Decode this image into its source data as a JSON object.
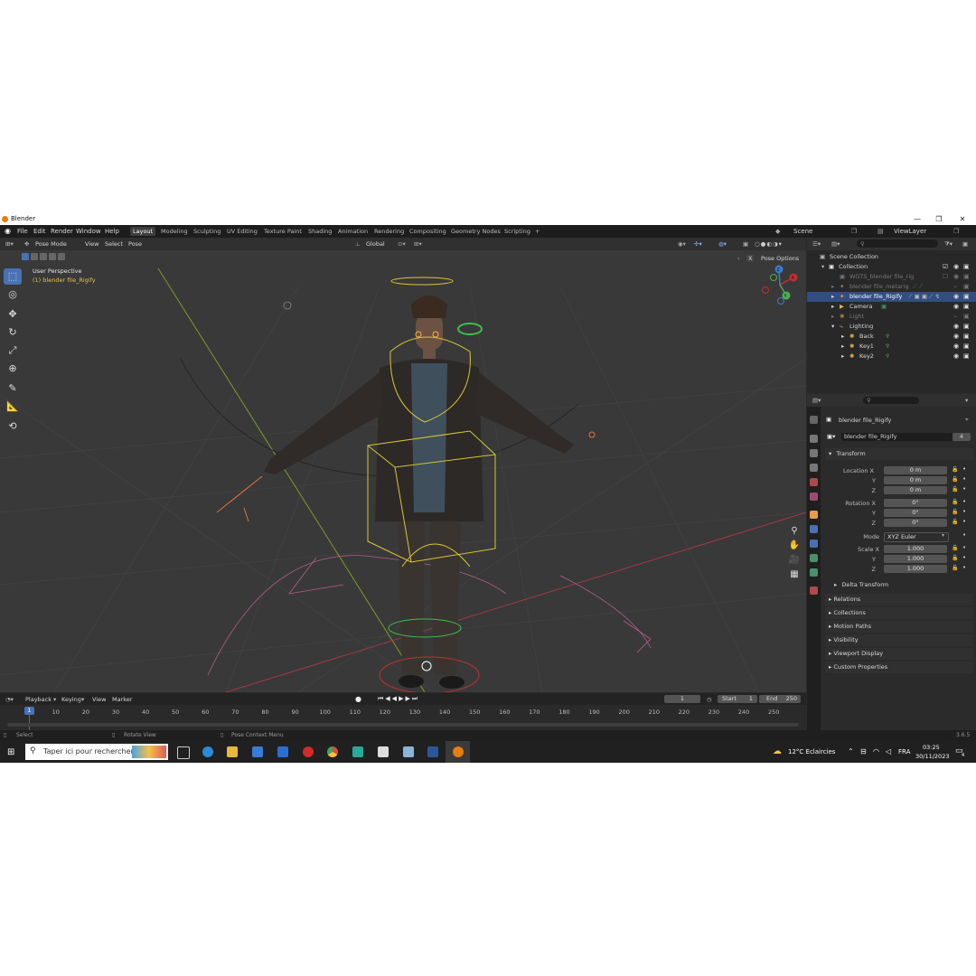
{
  "window": {
    "title": "Blender",
    "minimize": "—",
    "maximize": "❐",
    "close": "✕"
  },
  "menu": [
    "File",
    "Edit",
    "Render",
    "Window",
    "Help"
  ],
  "workspaces": [
    "Layout",
    "Modeling",
    "Sculpting",
    "UV Editing",
    "Texture Paint",
    "Shading",
    "Animation",
    "Rendering",
    "Compositing",
    "Geometry Nodes",
    "Scripting",
    "+"
  ],
  "scene": {
    "name": "Scene",
    "view_layer": "ViewLayer"
  },
  "viewport": {
    "mode": "Pose Mode",
    "header_menus": [
      "View",
      "Select",
      "Pose"
    ],
    "orientation": "Global",
    "pose_options": "Pose Options",
    "title": "User Perspective",
    "subtitle": "(1) blender file_Rigify",
    "x_button": "X",
    "gizmo": {
      "x": "X",
      "y": "Y",
      "z": "Z"
    }
  },
  "outliner": {
    "rows": [
      {
        "label": "Scene Collection"
      },
      {
        "label": "Collection"
      },
      {
        "label": "WGTS_blender file_rig"
      },
      {
        "label": "blender file_metarig"
      },
      {
        "label": "blender file_Rigify"
      },
      {
        "label": "Camera"
      },
      {
        "label": "Light"
      },
      {
        "label": "Lighting"
      },
      {
        "label": "Back"
      },
      {
        "label": "Key1"
      },
      {
        "label": "Key2"
      }
    ]
  },
  "properties": {
    "object_name": "blender file_Rigify",
    "data_name": "blender file_Rigify",
    "users": "4",
    "transform": {
      "header": "Transform",
      "location_label": "Location X",
      "location": [
        "0 m",
        "0 m",
        "0 m"
      ],
      "rotation_label": "Rotation X",
      "rotation": [
        "0°",
        "0°",
        "0°"
      ],
      "mode_label": "Mode",
      "mode": "XYZ Euler",
      "scale_label": "Scale X",
      "scale": [
        "1.000",
        "1.000",
        "1.000"
      ],
      "y": "Y",
      "z": "Z"
    },
    "delta": "Delta Transform",
    "panels": [
      "Relations",
      "Collections",
      "Motion Paths",
      "Visibility",
      "Viewport Display",
      "Custom Properties"
    ]
  },
  "timeline": {
    "menus": [
      "Playback",
      "Keying",
      "View",
      "Marker"
    ],
    "current_frame": "1",
    "start_label": "Start",
    "start": "1",
    "end_label": "End",
    "end": "250",
    "ruler": [
      "1",
      "10",
      "20",
      "30",
      "40",
      "50",
      "60",
      "70",
      "80",
      "90",
      "100",
      "110",
      "120",
      "130",
      "140",
      "150",
      "160",
      "170",
      "180",
      "190",
      "200",
      "210",
      "220",
      "230",
      "240",
      "250"
    ]
  },
  "statusbar": {
    "select": "Select",
    "rotate": "Rotate View",
    "context": "Pose Context Menu",
    "version": "3.6.5"
  },
  "taskbar": {
    "search_placeholder": "Taper ici pour rechercher",
    "weather": "12°C  Eclaircies",
    "language": "FRA",
    "time": "03:25",
    "date": "30/11/2023",
    "notifications": "4"
  },
  "colors": {
    "accent": "#4772b3",
    "selection": "#334d80",
    "blender_orange": "#e87d0d",
    "rig_yellow": "#d8c534"
  }
}
